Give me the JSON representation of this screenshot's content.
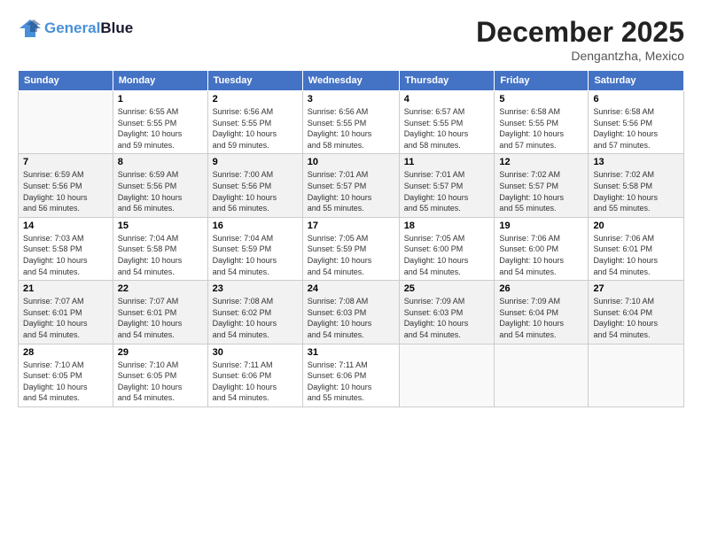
{
  "header": {
    "logo_line1": "General",
    "logo_line2": "Blue",
    "month": "December 2025",
    "location": "Dengantzha, Mexico"
  },
  "weekdays": [
    "Sunday",
    "Monday",
    "Tuesday",
    "Wednesday",
    "Thursday",
    "Friday",
    "Saturday"
  ],
  "weeks": [
    [
      {
        "day": "",
        "info": ""
      },
      {
        "day": "1",
        "info": "Sunrise: 6:55 AM\nSunset: 5:55 PM\nDaylight: 10 hours\nand 59 minutes."
      },
      {
        "day": "2",
        "info": "Sunrise: 6:56 AM\nSunset: 5:55 PM\nDaylight: 10 hours\nand 59 minutes."
      },
      {
        "day": "3",
        "info": "Sunrise: 6:56 AM\nSunset: 5:55 PM\nDaylight: 10 hours\nand 58 minutes."
      },
      {
        "day": "4",
        "info": "Sunrise: 6:57 AM\nSunset: 5:55 PM\nDaylight: 10 hours\nand 58 minutes."
      },
      {
        "day": "5",
        "info": "Sunrise: 6:58 AM\nSunset: 5:55 PM\nDaylight: 10 hours\nand 57 minutes."
      },
      {
        "day": "6",
        "info": "Sunrise: 6:58 AM\nSunset: 5:56 PM\nDaylight: 10 hours\nand 57 minutes."
      }
    ],
    [
      {
        "day": "7",
        "info": "Sunrise: 6:59 AM\nSunset: 5:56 PM\nDaylight: 10 hours\nand 56 minutes."
      },
      {
        "day": "8",
        "info": "Sunrise: 6:59 AM\nSunset: 5:56 PM\nDaylight: 10 hours\nand 56 minutes."
      },
      {
        "day": "9",
        "info": "Sunrise: 7:00 AM\nSunset: 5:56 PM\nDaylight: 10 hours\nand 56 minutes."
      },
      {
        "day": "10",
        "info": "Sunrise: 7:01 AM\nSunset: 5:57 PM\nDaylight: 10 hours\nand 55 minutes."
      },
      {
        "day": "11",
        "info": "Sunrise: 7:01 AM\nSunset: 5:57 PM\nDaylight: 10 hours\nand 55 minutes."
      },
      {
        "day": "12",
        "info": "Sunrise: 7:02 AM\nSunset: 5:57 PM\nDaylight: 10 hours\nand 55 minutes."
      },
      {
        "day": "13",
        "info": "Sunrise: 7:02 AM\nSunset: 5:58 PM\nDaylight: 10 hours\nand 55 minutes."
      }
    ],
    [
      {
        "day": "14",
        "info": "Sunrise: 7:03 AM\nSunset: 5:58 PM\nDaylight: 10 hours\nand 54 minutes."
      },
      {
        "day": "15",
        "info": "Sunrise: 7:04 AM\nSunset: 5:58 PM\nDaylight: 10 hours\nand 54 minutes."
      },
      {
        "day": "16",
        "info": "Sunrise: 7:04 AM\nSunset: 5:59 PM\nDaylight: 10 hours\nand 54 minutes."
      },
      {
        "day": "17",
        "info": "Sunrise: 7:05 AM\nSunset: 5:59 PM\nDaylight: 10 hours\nand 54 minutes."
      },
      {
        "day": "18",
        "info": "Sunrise: 7:05 AM\nSunset: 6:00 PM\nDaylight: 10 hours\nand 54 minutes."
      },
      {
        "day": "19",
        "info": "Sunrise: 7:06 AM\nSunset: 6:00 PM\nDaylight: 10 hours\nand 54 minutes."
      },
      {
        "day": "20",
        "info": "Sunrise: 7:06 AM\nSunset: 6:01 PM\nDaylight: 10 hours\nand 54 minutes."
      }
    ],
    [
      {
        "day": "21",
        "info": "Sunrise: 7:07 AM\nSunset: 6:01 PM\nDaylight: 10 hours\nand 54 minutes."
      },
      {
        "day": "22",
        "info": "Sunrise: 7:07 AM\nSunset: 6:01 PM\nDaylight: 10 hours\nand 54 minutes."
      },
      {
        "day": "23",
        "info": "Sunrise: 7:08 AM\nSunset: 6:02 PM\nDaylight: 10 hours\nand 54 minutes."
      },
      {
        "day": "24",
        "info": "Sunrise: 7:08 AM\nSunset: 6:03 PM\nDaylight: 10 hours\nand 54 minutes."
      },
      {
        "day": "25",
        "info": "Sunrise: 7:09 AM\nSunset: 6:03 PM\nDaylight: 10 hours\nand 54 minutes."
      },
      {
        "day": "26",
        "info": "Sunrise: 7:09 AM\nSunset: 6:04 PM\nDaylight: 10 hours\nand 54 minutes."
      },
      {
        "day": "27",
        "info": "Sunrise: 7:10 AM\nSunset: 6:04 PM\nDaylight: 10 hours\nand 54 minutes."
      }
    ],
    [
      {
        "day": "28",
        "info": "Sunrise: 7:10 AM\nSunset: 6:05 PM\nDaylight: 10 hours\nand 54 minutes."
      },
      {
        "day": "29",
        "info": "Sunrise: 7:10 AM\nSunset: 6:05 PM\nDaylight: 10 hours\nand 54 minutes."
      },
      {
        "day": "30",
        "info": "Sunrise: 7:11 AM\nSunset: 6:06 PM\nDaylight: 10 hours\nand 54 minutes."
      },
      {
        "day": "31",
        "info": "Sunrise: 7:11 AM\nSunset: 6:06 PM\nDaylight: 10 hours\nand 55 minutes."
      },
      {
        "day": "",
        "info": ""
      },
      {
        "day": "",
        "info": ""
      },
      {
        "day": "",
        "info": ""
      }
    ]
  ]
}
